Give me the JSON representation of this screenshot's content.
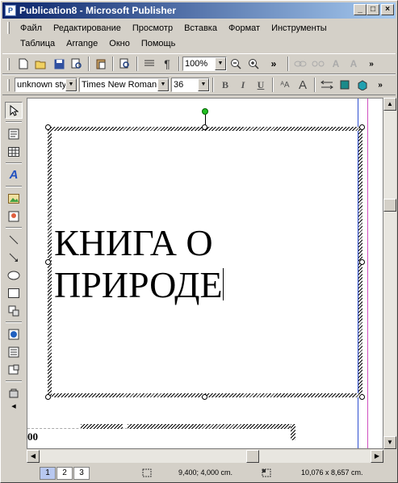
{
  "window": {
    "title": "Publication8 - Microsoft Publisher",
    "app_icon": "P",
    "controls": {
      "minimize": "_",
      "maximize": "□",
      "close": "×"
    }
  },
  "menu": {
    "row1": [
      "Файл",
      "Редактирование",
      "Просмотр",
      "Вставка",
      "Формат",
      "Инструменты"
    ],
    "row2": [
      "Таблица",
      "Arrange",
      "Окно",
      "Помощь"
    ]
  },
  "standard_toolbar": {
    "zoom": "100%",
    "icons": [
      "new-icon",
      "open-icon",
      "save-icon",
      "print-preview-icon",
      "paste-icon",
      "search-icon",
      "columns-icon",
      "pilcrow-icon",
      "zoom-out-icon",
      "zoom-in-icon",
      "link-icon",
      "unlink-icon",
      "text-fit-icon",
      "text-grow-icon"
    ]
  },
  "format_toolbar": {
    "style": "unknown sty",
    "font": "Times New Roman",
    "size": "36",
    "bold": "B",
    "italic": "I",
    "underline": "U"
  },
  "document": {
    "frame_text_line1": "КНИГА О",
    "frame_text_line2": "ПРИРОДЕ",
    "next_page_label": "00"
  },
  "status": {
    "pages": [
      "1",
      "2",
      "3"
    ],
    "active_page": "1",
    "position": "9,400; 4,000 cm.",
    "size": "10,076 x   8,657 cm."
  },
  "colors": {
    "title_start": "#0a246a",
    "title_end": "#a6caf0",
    "guide_blue": "#3050d0",
    "guide_pink": "#d050c0"
  }
}
